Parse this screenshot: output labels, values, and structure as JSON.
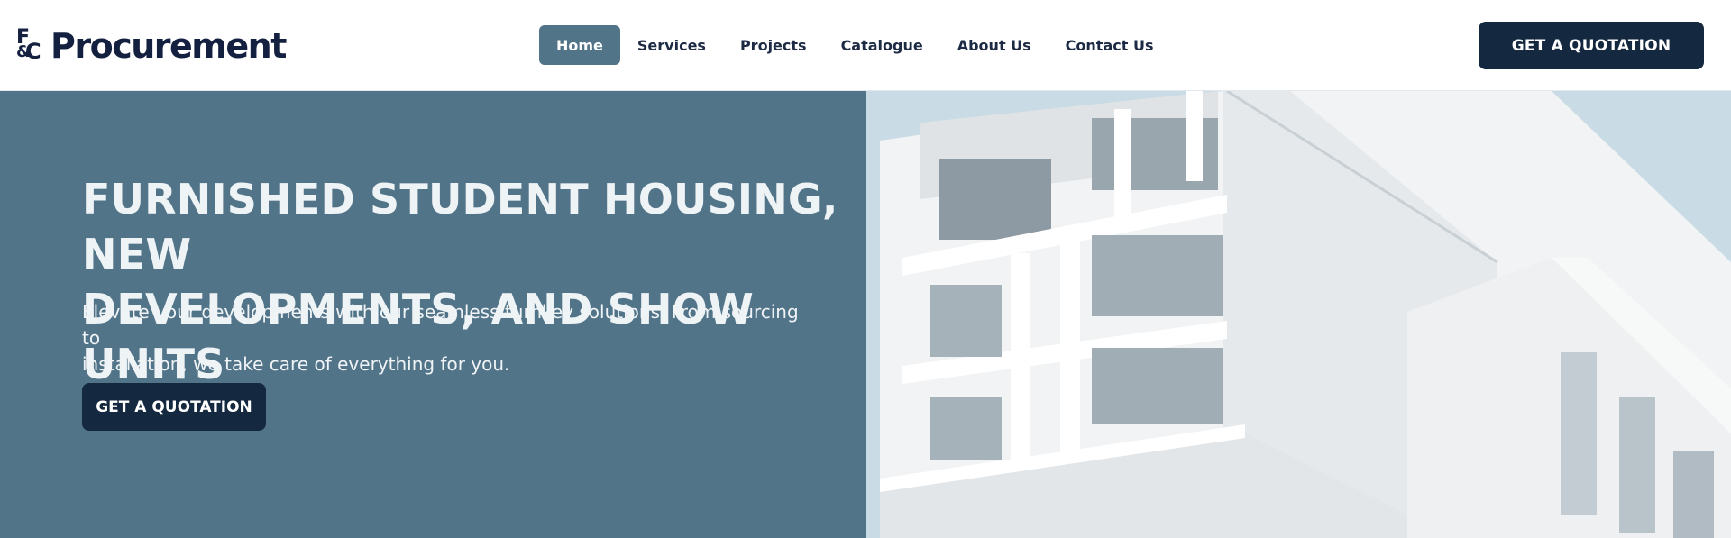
{
  "brand": {
    "mark": {
      "f": "F",
      "amp": "&",
      "c": "C"
    },
    "name": "Procurement"
  },
  "nav": {
    "items": [
      {
        "label": "Home",
        "active": true
      },
      {
        "label": "Services",
        "active": false
      },
      {
        "label": "Projects",
        "active": false
      },
      {
        "label": "Catalogue",
        "active": false
      },
      {
        "label": "About Us",
        "active": false
      },
      {
        "label": "Contact Us",
        "active": false
      }
    ]
  },
  "header": {
    "cta_label": "GET A QUOTATION"
  },
  "hero": {
    "title_line1": "FURNISHED STUDENT HOUSING, NEW",
    "title_line2": "DEVELOPMENTS, AND SHOW UNITS",
    "subtitle_line1": "Elevate your developments with our seamless turnkey solutions. From sourcing to",
    "subtitle_line2": "installation, we take care of everything for you.",
    "cta_label": "GET A QUOTATION"
  },
  "colors": {
    "brand_navy": "#14283f",
    "hero_panel": "#527488",
    "nav_active": "#527488",
    "sky": "#c9dbe4"
  }
}
